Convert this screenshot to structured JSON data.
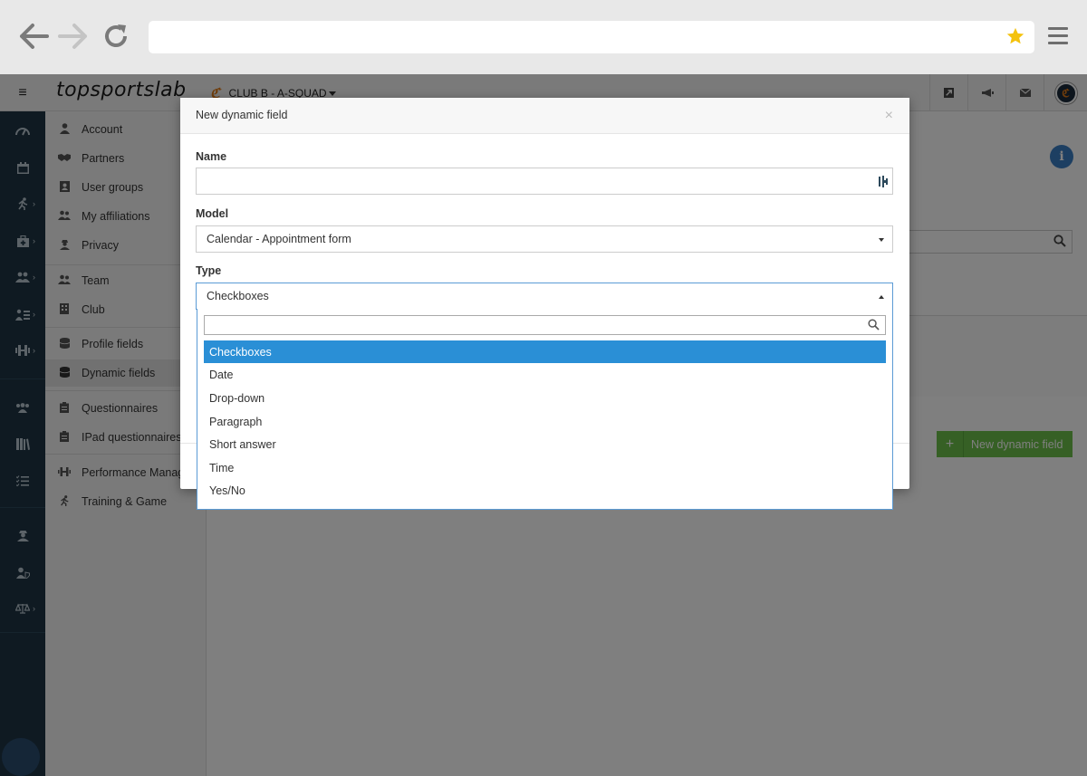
{
  "browser": {
    "back_icon": "arrow-left-icon",
    "forward_icon": "arrow-right-icon",
    "reload_icon": "reload-icon",
    "address_value": "",
    "bookmark_icon": "star-icon",
    "menu_icon": "hamburger-menu-icon",
    "star_color": "#f4c20d"
  },
  "topbar": {
    "menu_icon": "hamburger-icon",
    "logo": "topsportslab",
    "club_label": "CLUB B - A-SQUAD",
    "club_icon_glyph": "ℭ",
    "icons": [
      "external-link-icon",
      "megaphone-icon",
      "envelope-icon",
      "user-avatar-icon"
    ]
  },
  "icon_rail": {
    "items": [
      {
        "icon": "dashboard-icon",
        "has_arrow": false
      },
      {
        "icon": "calendar-icon",
        "has_arrow": false
      },
      {
        "icon": "running-icon",
        "has_arrow": true
      },
      {
        "icon": "medical-kit-icon",
        "has_arrow": true
      },
      {
        "icon": "team-icon",
        "has_arrow": true
      },
      {
        "icon": "id-card-icon",
        "has_arrow": true
      },
      {
        "icon": "dumbbell-icon",
        "has_arrow": true
      },
      {
        "icon": "group-icon",
        "has_arrow": false
      },
      {
        "icon": "library-icon",
        "has_arrow": false
      },
      {
        "icon": "checklist-icon",
        "has_arrow": false
      },
      {
        "icon": "user-secret-icon",
        "has_arrow": false
      },
      {
        "icon": "user-shield-icon",
        "has_arrow": false
      },
      {
        "icon": "scale-icon",
        "has_arrow": true
      }
    ],
    "arrow_glyph": "›"
  },
  "submenu": {
    "items": [
      {
        "label": "Account",
        "icon": "user-icon"
      },
      {
        "label": "Partners",
        "icon": "handshake-icon"
      },
      {
        "label": "User groups",
        "icon": "address-card-icon"
      },
      {
        "label": "My affiliations",
        "icon": "users-icon"
      },
      {
        "label": "Privacy",
        "icon": "user-lock-icon"
      },
      {
        "label": "Team",
        "icon": "team-icon"
      },
      {
        "label": "Club",
        "icon": "building-icon"
      },
      {
        "label": "Profile fields",
        "icon": "database-icon"
      },
      {
        "label": "Dynamic fields",
        "icon": "database-icon"
      },
      {
        "label": "Questionnaires",
        "icon": "clipboard-icon"
      },
      {
        "label": "IPad questionnaires",
        "icon": "clipboard-icon"
      },
      {
        "label": "Performance Management",
        "icon": "dumbbell-icon"
      },
      {
        "label": "Training & Game",
        "icon": "running-icon"
      }
    ],
    "active_label": "Dynamic fields"
  },
  "content": {
    "info_icon": "info-icon",
    "info_glyph": "i",
    "search_icon": "search-icon",
    "new_button_label": "New dynamic field",
    "new_button_icon": "plus-icon",
    "new_button_color": "#6cc04a"
  },
  "modal": {
    "title": "New dynamic field",
    "close_glyph": "×",
    "name_label": "Name",
    "name_value": "",
    "model_label": "Model",
    "model_value": "Calendar - Appointment form",
    "type_label": "Type",
    "type_value": "Checkboxes"
  },
  "type_dropdown": {
    "search_value": "",
    "options": [
      "Checkboxes",
      "Date",
      "Drop-down",
      "Paragraph",
      "Short answer",
      "Time",
      "Yes/No"
    ],
    "selected": "Checkboxes",
    "highlight_color": "#2a8fd6"
  }
}
